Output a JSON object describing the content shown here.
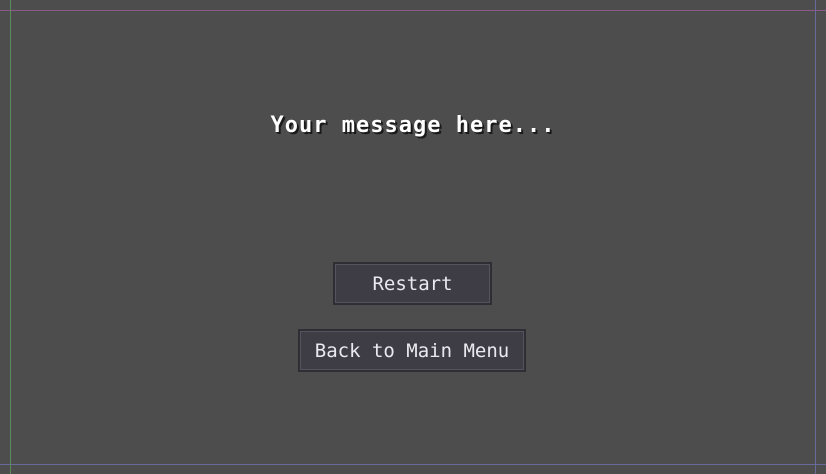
{
  "screen": {
    "message": "Your message here...",
    "buttons": {
      "restart_label": "Restart",
      "main_menu_label": "Back to Main Menu"
    }
  },
  "colors": {
    "background": "#4d4d4d",
    "button_fill": "#3e3d45",
    "text": "#ffffff"
  }
}
